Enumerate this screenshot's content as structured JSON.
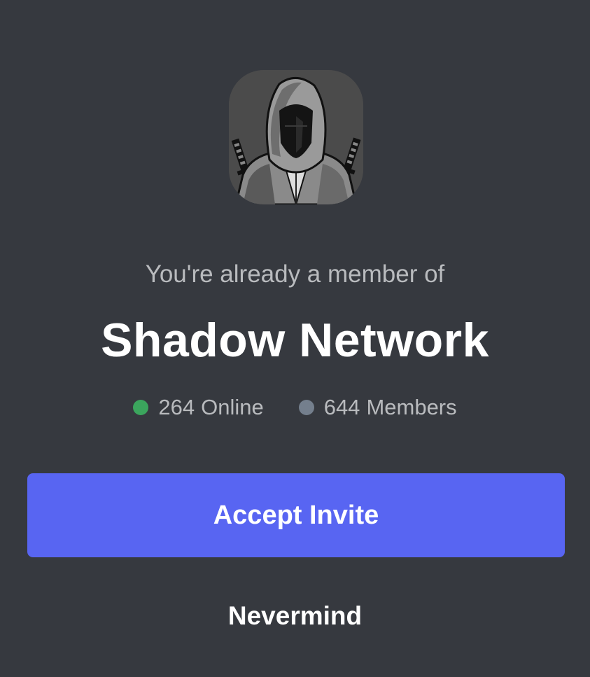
{
  "invite": {
    "subtitle": "You're already a member of",
    "server_name": "Shadow Network",
    "server_icon": "hooded-ninja-avatar",
    "stats": {
      "online_count": "264",
      "online_label": "Online",
      "members_count": "644",
      "members_label": "Members"
    },
    "accept_label": "Accept Invite",
    "nevermind_label": "Nevermind"
  },
  "colors": {
    "background": "#36393f",
    "accent": "#5865f2",
    "online_dot": "#3ba55d",
    "members_dot": "#747f8d",
    "muted_text": "#b9bbbe",
    "title_text": "#ffffff"
  }
}
